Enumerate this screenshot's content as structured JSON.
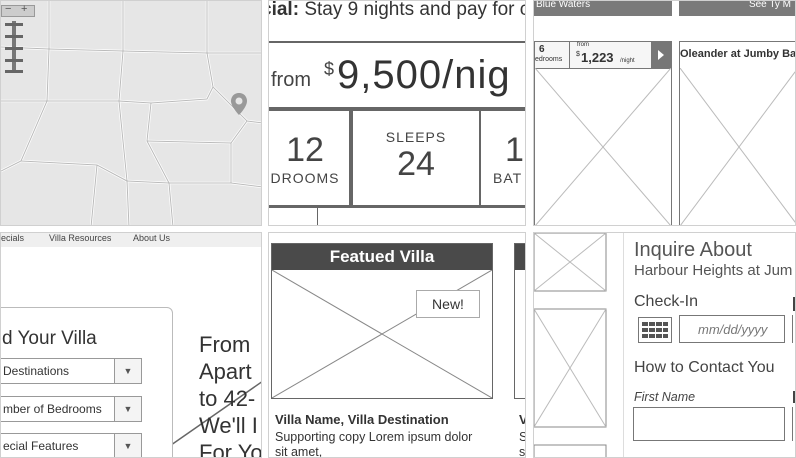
{
  "map": {
    "zoom_plus": "+",
    "zoom_minus": "−",
    "marker_icon": "map-pin-icon"
  },
  "special": {
    "promo_prefix": "cial:",
    "promo_text": "Stay 9 nights and pay for c",
    "from_label": "from",
    "currency": "$",
    "price": "9,500/nig",
    "stats": [
      {
        "value": "12",
        "label": "DROOMS"
      },
      {
        "value": "24",
        "label": "SLEEPS"
      },
      {
        "value": "1",
        "label": "BAT"
      }
    ]
  },
  "listing": {
    "bar_left": "Blue Waters",
    "bar_right": "See Ty M",
    "bedrooms_num": "6",
    "bedrooms_label": "edrooms",
    "from_label": "from",
    "price_currency": "$",
    "price": "1,223",
    "price_unit": "/night",
    "card_title": "Oleander at Jumby Bay"
  },
  "finder": {
    "nav": [
      "ecials",
      "Villa Resources",
      "About Us"
    ],
    "heading": "d Your Villa",
    "selects": [
      "Destinations",
      "mber of Bedrooms",
      "ecial Features"
    ],
    "hero_lines": [
      "From",
      "Apart",
      "to 42-",
      "We'll I",
      "For Yo"
    ]
  },
  "featured": {
    "header": "Featued Villa",
    "badge": "New!",
    "title": "Villa Name, Villa Destination",
    "copy_line1": "Supporting copy Lorem ipsum dolor",
    "copy_line2": "sit amet,",
    "side_title": "V",
    "side_copy1": "S",
    "side_copy2": "s"
  },
  "inquire": {
    "title": "Inquire About",
    "subtitle": "Harbour Heights at Jum",
    "checkin_label": "Check-In",
    "checkin_placeholder": "mm/dd/yyyy",
    "contact_label": "How to Contact You",
    "first_name_label": "First Name",
    "calendar_icon": "calendar-icon"
  }
}
